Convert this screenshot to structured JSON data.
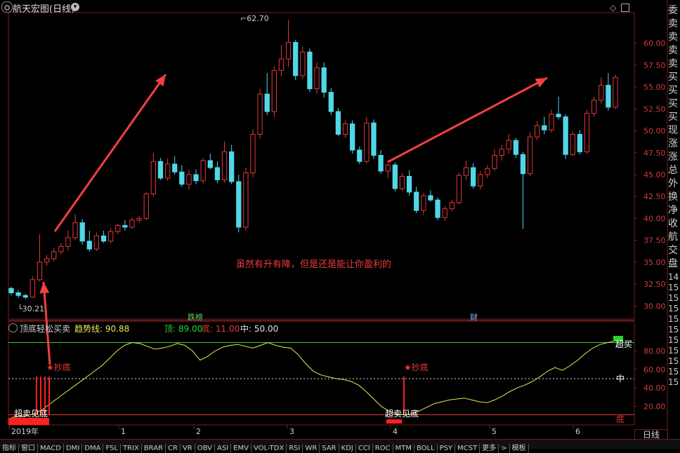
{
  "window": {
    "title": "航天宏图(日线)",
    "top_right_icons": [
      "diamond-icon",
      "box-icon"
    ]
  },
  "price_chart": {
    "high_label": "62.70",
    "low_label": "30.21",
    "annotation": "虽然有升有降，但是还是能让你盈利的",
    "y_ticks": [
      "60.00",
      "57.50",
      "55.00",
      "52.50",
      "50.00",
      "47.50",
      "45.00",
      "42.50",
      "40.00",
      "37.50",
      "35.00",
      "32.50",
      "30.00"
    ],
    "y_range": [
      28.5,
      63.5
    ],
    "markers": [
      {
        "label": "跌榜",
        "color": "#5fd35f"
      },
      {
        "label": "财",
        "color": "#8fb4ff"
      }
    ]
  },
  "indicator": {
    "name": "顶底轻松买卖",
    "trend_label": "趋势线: 90.88",
    "top_label": "顶: 89.00",
    "bottom_label": "底: 11.00",
    "mid_label": "中: 50.00",
    "y_ticks": [
      "80.00",
      "60.00",
      "40.00",
      "20.00"
    ],
    "y_range": [
      0,
      100
    ],
    "levels": {
      "top": 89,
      "mid": 50,
      "bottom": 11
    },
    "text_oversold": "超卖见底",
    "text_buy": "★抄底",
    "text_overbought": "超买",
    "text_mid": "中",
    "text_bottom": "底"
  },
  "x_axis": {
    "labels": [
      "2019年",
      "1",
      "2",
      "3",
      "4",
      "5",
      "6"
    ]
  },
  "right_panel": {
    "chars": [
      "委",
      "卖",
      "卖",
      "卖",
      "卖",
      "买",
      "买",
      "买",
      "买",
      "现",
      "涨",
      "涨",
      "总",
      "外",
      "换",
      "净",
      "收",
      "航",
      "交",
      "盘",
      "14",
      "15",
      "15",
      "15",
      "15",
      "15",
      "15",
      "15",
      "15",
      "15",
      "15"
    ],
    "tab_label": "日线"
  },
  "tabs": [
    "指标",
    "窗口",
    "MACD",
    "DMI",
    "DMA",
    "FSL",
    "TRIX",
    "BRAR",
    "CR",
    "VR",
    "OBV",
    "ASI",
    "EMV",
    "VOL-TDX",
    "RSI",
    "WR",
    "SAR",
    "KDJ",
    "CCI",
    "ROC",
    "MTM",
    "BOLL",
    "PSY",
    "MCST",
    "更多",
    ">",
    "模板"
  ],
  "colors": {
    "up": "#e0393a",
    "down": "#4fd8e8",
    "trend": "#e8e85a",
    "top_line": "#2fd12f",
    "arrow": "#f04040",
    "grid": "#7a1e1e"
  },
  "chart_data": [
    {
      "type": "candlestick",
      "title": "航天宏图(日线)",
      "x": [
        "2019年",
        "1",
        "2",
        "3",
        "4",
        "5",
        "6"
      ],
      "ylim": [
        28.5,
        63.5
      ],
      "ohlc": [
        [
          32.0,
          32.2,
          31.2,
          31.5
        ],
        [
          31.5,
          31.8,
          30.9,
          31.2
        ],
        [
          31.2,
          31.4,
          30.8,
          31.0
        ],
        [
          31.0,
          33.4,
          30.9,
          33.0
        ],
        [
          33.0,
          38.2,
          32.8,
          35.0
        ],
        [
          35.0,
          35.8,
          34.6,
          35.4
        ],
        [
          35.4,
          36.6,
          35.1,
          36.2
        ],
        [
          36.2,
          37.2,
          35.9,
          36.8
        ],
        [
          36.8,
          38.6,
          36.3,
          37.8
        ],
        [
          37.8,
          40.5,
          37.5,
          39.5
        ],
        [
          39.5,
          39.9,
          37.0,
          37.4
        ],
        [
          37.4,
          38.6,
          36.2,
          36.5
        ],
        [
          36.5,
          38.4,
          36.3,
          38.0
        ],
        [
          38.0,
          38.6,
          37.2,
          37.4
        ],
        [
          37.4,
          38.9,
          37.2,
          38.5
        ],
        [
          38.5,
          39.4,
          38.2,
          39.2
        ],
        [
          39.2,
          39.8,
          38.6,
          39.0
        ],
        [
          39.0,
          40.1,
          38.8,
          39.8
        ],
        [
          39.8,
          40.3,
          39.5,
          40.0
        ],
        [
          40.0,
          43.0,
          39.8,
          42.8
        ],
        [
          42.8,
          47.5,
          42.5,
          46.5
        ],
        [
          46.5,
          46.9,
          44.4,
          44.6
        ],
        [
          44.6,
          46.8,
          44.3,
          46.2
        ],
        [
          46.2,
          47.1,
          45.0,
          45.3
        ],
        [
          45.3,
          46.1,
          43.6,
          43.9
        ],
        [
          43.9,
          45.5,
          43.3,
          45.0
        ],
        [
          45.0,
          45.6,
          43.9,
          44.3
        ],
        [
          44.3,
          46.9,
          44.0,
          46.6
        ],
        [
          46.6,
          47.4,
          45.6,
          45.8
        ],
        [
          45.8,
          46.5,
          44.0,
          44.4
        ],
        [
          44.4,
          48.8,
          44.1,
          47.6
        ],
        [
          47.6,
          48.4,
          43.9,
          44.2
        ],
        [
          44.2,
          45.0,
          38.4,
          39.0
        ],
        [
          39.0,
          45.8,
          38.6,
          45.2
        ],
        [
          45.2,
          50.2,
          44.7,
          49.6
        ],
        [
          49.6,
          54.8,
          49.1,
          54.2
        ],
        [
          54.2,
          56.6,
          51.8,
          52.2
        ],
        [
          52.2,
          57.4,
          51.6,
          56.9
        ],
        [
          56.9,
          59.8,
          56.2,
          58.2
        ],
        [
          58.2,
          62.7,
          57.3,
          60.1
        ],
        [
          60.1,
          60.4,
          55.8,
          56.3
        ],
        [
          56.3,
          59.6,
          55.9,
          59.0
        ],
        [
          59.0,
          59.4,
          54.4,
          54.8
        ],
        [
          54.8,
          57.8,
          54.2,
          57.2
        ],
        [
          57.2,
          57.8,
          53.8,
          54.4
        ],
        [
          54.4,
          54.9,
          51.8,
          52.2
        ],
        [
          52.2,
          52.6,
          49.4,
          49.6
        ],
        [
          49.6,
          51.2,
          49.2,
          50.8
        ],
        [
          50.8,
          51.2,
          47.4,
          47.8
        ],
        [
          47.8,
          48.2,
          46.2,
          46.5
        ],
        [
          46.5,
          51.6,
          46.3,
          50.9
        ],
        [
          50.9,
          51.3,
          46.8,
          47.2
        ],
        [
          47.2,
          47.8,
          45.1,
          45.4
        ],
        [
          45.4,
          46.3,
          44.6,
          46.1
        ],
        [
          46.1,
          46.4,
          43.1,
          43.4
        ],
        [
          43.4,
          45.2,
          43.1,
          44.8
        ],
        [
          44.8,
          45.5,
          42.6,
          43.0
        ],
        [
          43.0,
          43.6,
          40.6,
          40.9
        ],
        [
          40.9,
          42.9,
          40.4,
          42.6
        ],
        [
          42.6,
          43.2,
          41.9,
          42.1
        ],
        [
          42.1,
          42.4,
          39.8,
          40.1
        ],
        [
          40.1,
          41.4,
          39.7,
          41.1
        ],
        [
          41.1,
          42.1,
          40.8,
          41.8
        ],
        [
          41.8,
          45.2,
          41.6,
          44.9
        ],
        [
          44.9,
          46.6,
          44.4,
          45.8
        ],
        [
          45.8,
          46.3,
          43.4,
          43.7
        ],
        [
          43.7,
          45.4,
          43.3,
          45.0
        ],
        [
          45.0,
          46.1,
          44.6,
          45.7
        ],
        [
          45.7,
          47.9,
          45.4,
          47.2
        ],
        [
          47.2,
          48.4,
          46.6,
          47.9
        ],
        [
          47.9,
          49.6,
          47.4,
          48.9
        ],
        [
          48.9,
          49.2,
          46.9,
          47.3
        ],
        [
          47.3,
          47.6,
          38.8,
          45.1
        ],
        [
          45.1,
          49.8,
          44.8,
          49.3
        ],
        [
          49.3,
          51.1,
          48.9,
          50.6
        ],
        [
          50.6,
          51.6,
          49.6,
          50.1
        ],
        [
          50.1,
          52.4,
          49.8,
          51.9
        ],
        [
          51.9,
          53.9,
          51.3,
          51.6
        ],
        [
          51.6,
          51.9,
          46.8,
          47.3
        ],
        [
          47.3,
          49.9,
          47.1,
          49.6
        ],
        [
          49.6,
          50.1,
          47.3,
          47.6
        ],
        [
          47.6,
          52.4,
          47.4,
          52.0
        ],
        [
          52.0,
          53.9,
          51.6,
          53.5
        ],
        [
          53.5,
          56.1,
          53.1,
          55.2
        ],
        [
          55.2,
          56.6,
          52.3,
          52.7
        ],
        [
          52.7,
          56.4,
          52.5,
          56.1
        ]
      ]
    },
    {
      "type": "line",
      "title": "顶底轻松买卖",
      "ylim": [
        0,
        100
      ],
      "series": [
        {
          "name": "趋势线",
          "values": [
            8,
            9,
            10,
            12,
            16,
            22,
            28,
            34,
            40,
            46,
            52,
            58,
            64,
            72,
            80,
            86,
            89,
            88,
            85,
            82,
            83,
            85,
            88,
            86,
            80,
            70,
            74,
            80,
            84,
            86,
            87,
            85,
            83,
            86,
            89,
            86,
            84,
            83,
            76,
            66,
            58,
            54,
            52,
            50,
            49,
            47,
            43,
            36,
            28,
            20,
            15,
            12,
            11,
            12,
            15,
            19,
            23,
            25,
            27,
            28,
            29,
            27,
            25,
            24,
            27,
            31,
            36,
            40,
            43,
            47,
            52,
            58,
            62,
            59,
            64,
            70,
            77,
            83,
            87,
            89,
            90.88
          ]
        }
      ]
    }
  ]
}
